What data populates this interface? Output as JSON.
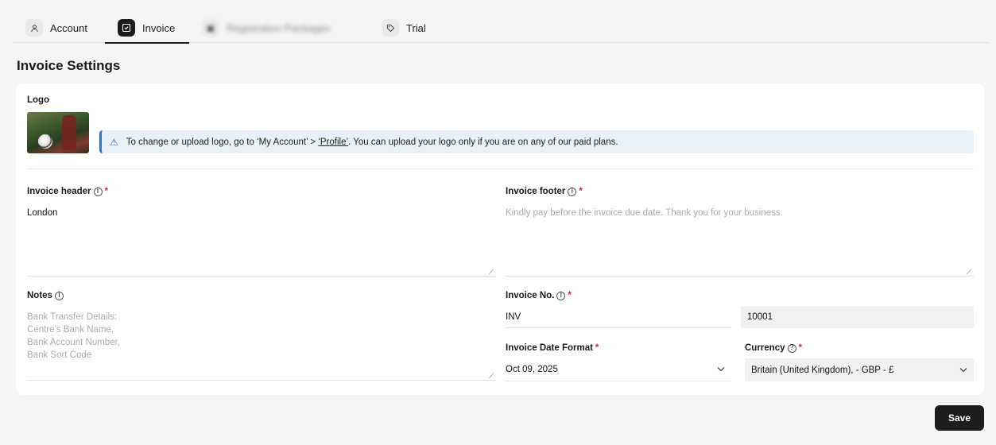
{
  "tabs": [
    {
      "label": "Account",
      "icon": "user-icon"
    },
    {
      "label": "Invoice",
      "icon": "invoice-icon"
    },
    {
      "label": "Registration Packages",
      "icon": "package-icon"
    },
    {
      "label": "Trial",
      "icon": "tag-icon"
    }
  ],
  "page": {
    "title": "Invoice Settings"
  },
  "logo": {
    "label": "Logo",
    "notice_prefix": "To change or upload logo, go to ‘My Account’ > ",
    "notice_link": "‘Profile’",
    "notice_suffix": ". You can upload your logo only if you are on any of our paid plans."
  },
  "invoice_header": {
    "label": "Invoice header",
    "value": "London"
  },
  "invoice_footer": {
    "label": "Invoice footer",
    "placeholder": "Kindly pay before the invoice due date. Thank you for your business."
  },
  "notes": {
    "label": "Notes",
    "placeholder_lines": [
      "Bank Transfer Details:",
      "Centre’s Bank Name,",
      "Bank Account Number,",
      "Bank Sort Code"
    ]
  },
  "invoice_no": {
    "label": "Invoice No.",
    "prefix": "INV",
    "number": "10001"
  },
  "date_format": {
    "label": "Invoice Date Format",
    "value": "Oct 09, 2025"
  },
  "currency": {
    "label": "Currency",
    "value": "Britain (United Kingdom), - GBP - £"
  },
  "actions": {
    "save_label": "Save"
  },
  "colors": {
    "accent": "#1c1c1e",
    "notice_border": "#2f6fd6",
    "required": "#e0202c"
  }
}
